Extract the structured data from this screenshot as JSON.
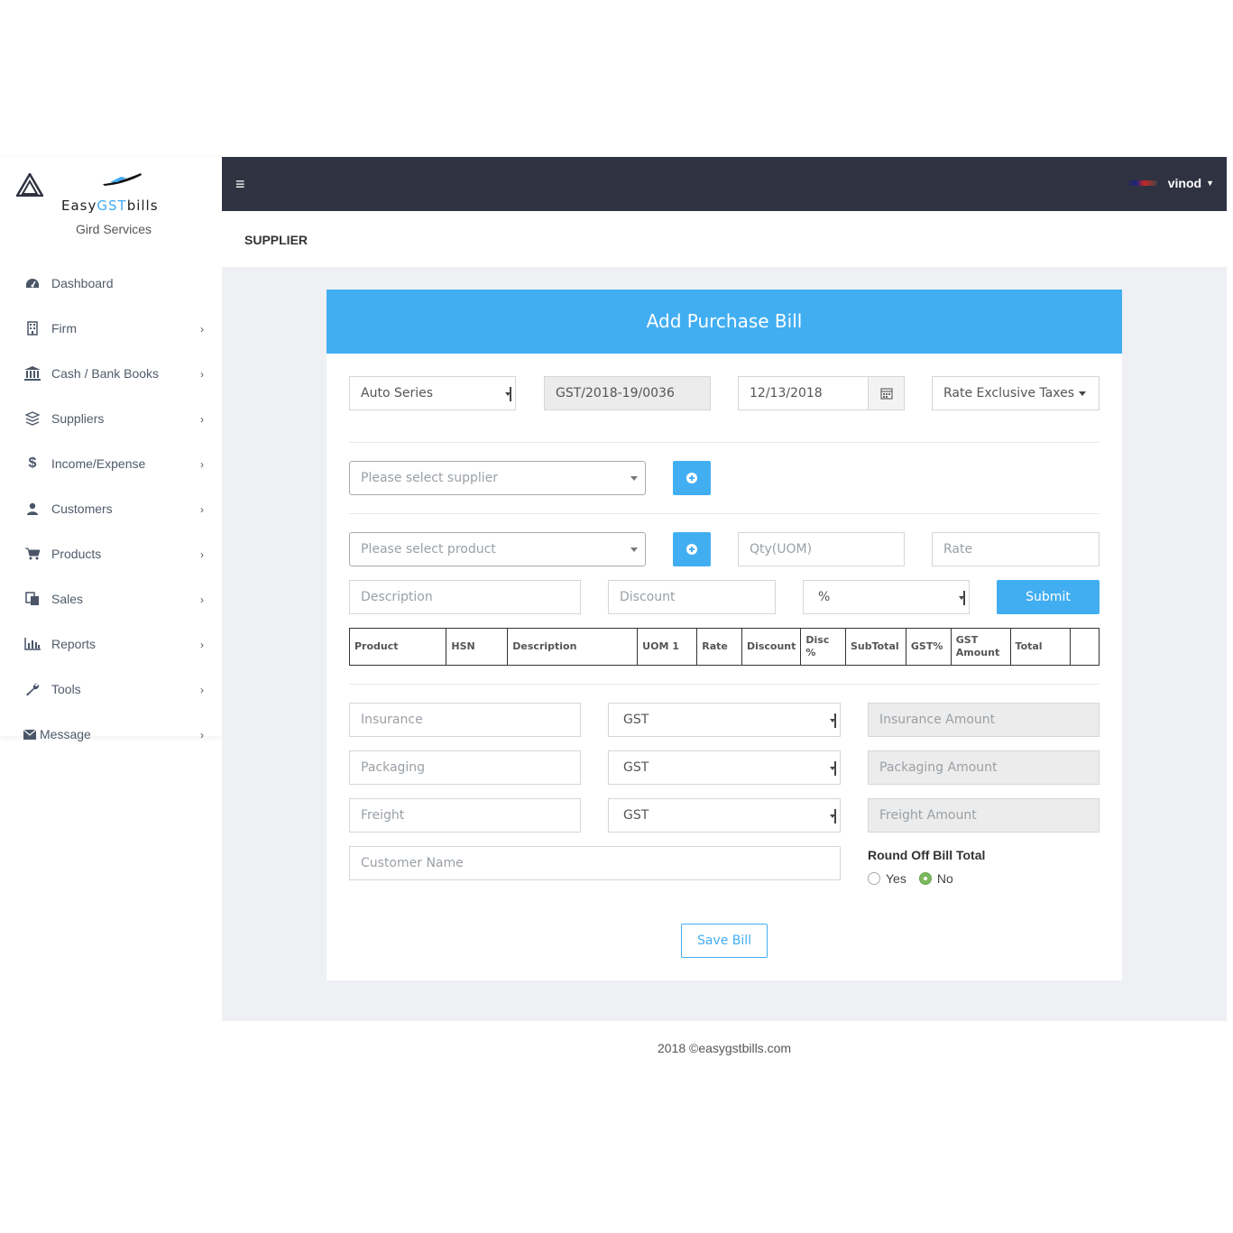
{
  "brand": {
    "name_prefix": "Easy",
    "name_accent": "GST",
    "name_suffix": "bills",
    "firm_name": "Gird Services"
  },
  "sidebar": {
    "items": [
      {
        "label": "Dashboard",
        "icon": "dashboard-icon"
      },
      {
        "label": "Firm",
        "icon": "building-icon"
      },
      {
        "label": "Cash / Bank Books",
        "icon": "bank-icon"
      },
      {
        "label": "Suppliers",
        "icon": "cubes-icon"
      },
      {
        "label": "Income/Expense",
        "icon": "dollar-icon"
      },
      {
        "label": "Customers",
        "icon": "user-icon"
      },
      {
        "label": "Products",
        "icon": "cart-icon"
      },
      {
        "label": "Sales",
        "icon": "copy-icon"
      },
      {
        "label": "Reports",
        "icon": "bar-chart-icon"
      },
      {
        "label": "Tools",
        "icon": "wrench-icon"
      },
      {
        "label": "Message",
        "icon": "envelope-icon"
      }
    ],
    "chevron": "›"
  },
  "topbar": {
    "menu_glyph": "≡",
    "username": "vinod"
  },
  "page": {
    "title": "SUPPLIER"
  },
  "form": {
    "heading": "Add Purchase Bill",
    "series": "Auto Series",
    "bill_no": "GST/2018-19/0036",
    "date": "12/13/2018",
    "rate_type": "Rate Exclusive Taxes",
    "supplier_placeholder": "Please select supplier",
    "product_placeholder": "Please select product",
    "qty_placeholder": "Qty(UOM)",
    "rate_placeholder": "Rate",
    "description_placeholder": "Description",
    "discount_placeholder": "Discount",
    "discount_type": "%",
    "submit_label": "Submit",
    "table_headers": [
      "Product",
      "HSN",
      "Description",
      "UOM 1",
      "Rate",
      "Discount",
      "Disc %",
      "SubTotal",
      "GST%",
      "GST Amount",
      "Total",
      ""
    ],
    "insurance_placeholder": "Insurance",
    "insurance_tax": "GST",
    "insurance_amount_placeholder": "Insurance Amount",
    "packaging_placeholder": "Packaging",
    "packaging_tax": "GST",
    "packaging_amount_placeholder": "Packaging Amount",
    "freight_placeholder": "Freight",
    "freight_tax": "GST",
    "freight_amount_placeholder": "Freight Amount",
    "customer_name_placeholder": "Customer Name",
    "round_off_title": "Round Off Bill Total",
    "round_off_yes": "Yes",
    "round_off_no": "No",
    "round_off_selected": "No",
    "save_label": "Save Bill"
  },
  "footer": {
    "text": "2018 ©easygstbills.com"
  },
  "colors": {
    "accent": "#42aef2",
    "topbar": "#2f3240",
    "content_bg": "#eef0f4",
    "radio_checked": "#7cb860"
  }
}
